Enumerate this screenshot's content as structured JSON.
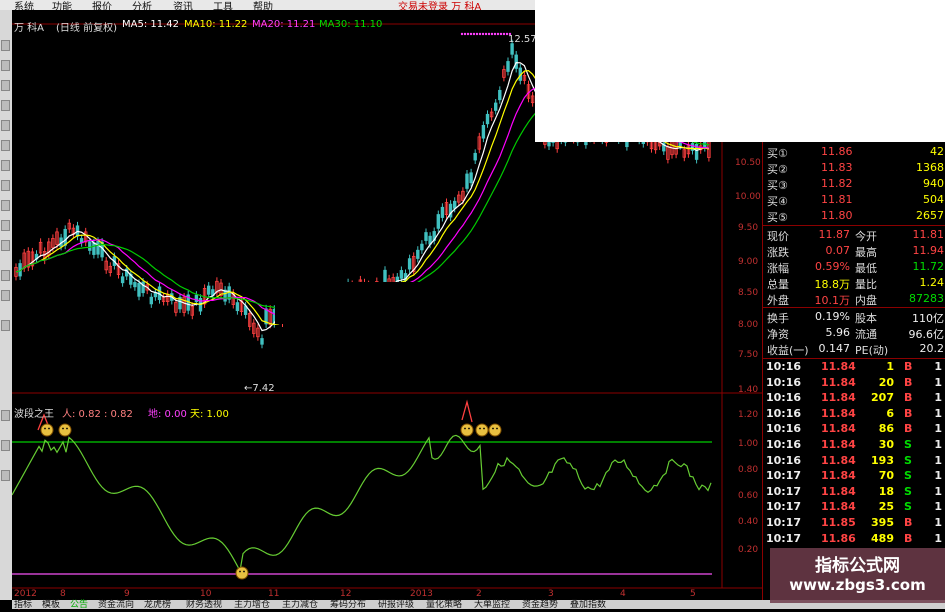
{
  "menu": {
    "items": [
      "系统",
      "功能",
      "报价",
      "分析",
      "资讯",
      "工具",
      "帮助"
    ],
    "hint": "交易未登录  万  科A"
  },
  "header": {
    "stock": "万  科A",
    "mode": "(日线 前复权)",
    "ma5": "MA5: 11.42",
    "ma10": "MA10: 11.22",
    "ma20": "MA20: 11.21",
    "ma30": "MA30: 11.10"
  },
  "price_axis": [
    "10.50",
    "10.00",
    "9.50",
    "9.00",
    "8.50",
    "8.00",
    "7.50"
  ],
  "high_label": "12.57",
  "low_label": "←7.42",
  "indicator": {
    "name": "波段之王",
    "ren": "人: 0.82 : 0.82",
    "di": "地: 0.00",
    "tian": "天: 1.00",
    "axis": [
      "1.40",
      "1.20",
      "1.00",
      "0.80",
      "0.60",
      "0.40",
      "0.20"
    ]
  },
  "date_axis": [
    "2012年",
    "8",
    "9",
    "10",
    "11",
    "12",
    "2013",
    "2",
    "3",
    "4",
    "5"
  ],
  "quote": {
    "bids": [
      {
        "label": "买①",
        "price": "11.86",
        "vol": "42"
      },
      {
        "label": "买②",
        "price": "11.83",
        "vol": "1368"
      },
      {
        "label": "买③",
        "price": "11.82",
        "vol": "940"
      },
      {
        "label": "买④",
        "price": "11.81",
        "vol": "504"
      },
      {
        "label": "买⑤",
        "price": "11.80",
        "vol": "2657"
      }
    ],
    "stats": [
      {
        "l1": "现价",
        "v1": "11.87",
        "c1": "red",
        "l2": "今开",
        "v2": "11.81",
        "c2": "red"
      },
      {
        "l1": "涨跌",
        "v1": "0.07",
        "c1": "red",
        "l2": "最高",
        "v2": "11.94",
        "c2": "red"
      },
      {
        "l1": "涨幅",
        "v1": "0.59%",
        "c1": "red",
        "l2": "最低",
        "v2": "11.72",
        "c2": "grn"
      },
      {
        "l1": "总量",
        "v1": "18.8万",
        "c1": "yel",
        "l2": "量比",
        "v2": "1.24",
        "c2": "yel"
      },
      {
        "l1": "外盘",
        "v1": "10.1万",
        "c1": "red",
        "l2": "内盘",
        "v2": "87283",
        "c2": "grn"
      }
    ],
    "stats2": [
      {
        "l1": "换手",
        "v1": "0.19%",
        "c1": "wht",
        "l2": "股本",
        "v2": "110亿",
        "c2": "wht"
      },
      {
        "l1": "净资",
        "v1": "5.96",
        "c1": "wht",
        "l2": "流通",
        "v2": "96.6亿",
        "c2": "wht"
      },
      {
        "l1": "收益(一)",
        "v1": "0.147",
        "c1": "wht",
        "l2": "PE(动)",
        "v2": "20.2",
        "c2": "wht"
      }
    ],
    "ticks": [
      {
        "t": "10:16",
        "p": "11.84",
        "v": "1",
        "bs": "B",
        "n": "1"
      },
      {
        "t": "10:16",
        "p": "11.84",
        "v": "20",
        "bs": "B",
        "n": "1"
      },
      {
        "t": "10:16",
        "p": "11.84",
        "v": "207",
        "bs": "B",
        "n": "1"
      },
      {
        "t": "10:16",
        "p": "11.84",
        "v": "6",
        "bs": "B",
        "n": "1"
      },
      {
        "t": "10:16",
        "p": "11.84",
        "v": "86",
        "bs": "B",
        "n": "1"
      },
      {
        "t": "10:16",
        "p": "11.84",
        "v": "30",
        "bs": "S",
        "n": "1"
      },
      {
        "t": "10:16",
        "p": "11.84",
        "v": "193",
        "bs": "S",
        "n": "1"
      },
      {
        "t": "10:17",
        "p": "11.84",
        "v": "70",
        "bs": "S",
        "n": "1"
      },
      {
        "t": "10:17",
        "p": "11.84",
        "v": "18",
        "bs": "S",
        "n": "1"
      },
      {
        "t": "10:17",
        "p": "11.84",
        "v": "25",
        "bs": "S",
        "n": "1"
      },
      {
        "t": "10:17",
        "p": "11.85",
        "v": "395",
        "bs": "B",
        "n": "1"
      },
      {
        "t": "10:17",
        "p": "11.86",
        "v": "489",
        "bs": "B",
        "n": "1"
      }
    ]
  },
  "tabs": [
    "指标",
    "模板",
    "公告",
    "资金流向",
    "龙虎榜",
    "财务透视",
    "主力增仓",
    "主力减仓",
    "筹码分布",
    "研报评级",
    "量化策略",
    "大单监控",
    "资金趋势",
    "叠加指数"
  ],
  "colors": {
    "ma5": "#ffffff",
    "ma10": "#ffff00",
    "ma20": "#ff00ff",
    "ma30": "#00cc00",
    "up": "#ff4040",
    "down": "#40c0c0",
    "accent": "#00cc00"
  },
  "watermark": {
    "line1": "指标公式网",
    "line2": "www.zbgs3.com"
  }
}
